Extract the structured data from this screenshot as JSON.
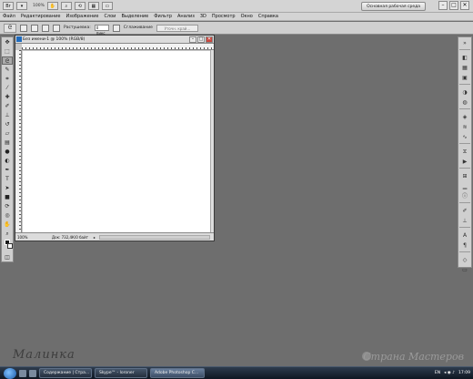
{
  "appbar": {
    "zoom": "100%",
    "workspace_button": "Основная рабочая среда"
  },
  "window_controls": {
    "minimize": "–",
    "maximize": "□",
    "close": "✕"
  },
  "menu": [
    "Файл",
    "Редактирование",
    "Изображение",
    "Слои",
    "Выделение",
    "Фильтр",
    "Анализ",
    "3D",
    "Просмотр",
    "Окно",
    "Справка"
  ],
  "options": {
    "feather_label": "Растушевка:",
    "feather_value": "0 пикс",
    "antialias_label": "Сглаживание",
    "refine_label": "Уточн. край..."
  },
  "document": {
    "title": "Без имени-1 @ 100% (RGB/8)",
    "zoom": "100%",
    "info": "Док: 732,4К/0 байт"
  },
  "taskbar": {
    "tasks": [
      "Содержание | Стра...",
      "Skype™ - loroner",
      "Adobe Photoshop C..."
    ],
    "lang": "EN",
    "time": "17:09"
  },
  "watermark": {
    "left": "Малинка",
    "right": "Страна Мастеров"
  }
}
